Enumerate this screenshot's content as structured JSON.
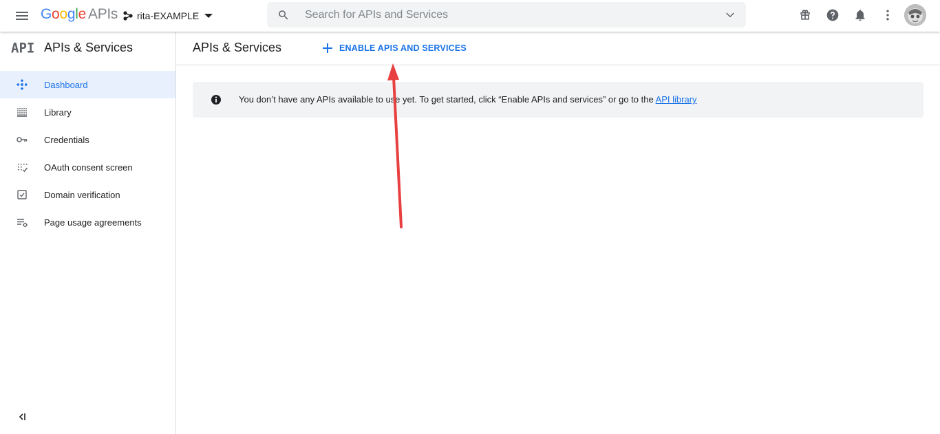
{
  "topbar": {
    "logo_letters": [
      "G",
      "o",
      "o",
      "g",
      "l",
      "e"
    ],
    "logo_suffix": "APIs",
    "project_name": "rita-EXAMPLE",
    "search_placeholder": "Search for APIs and Services"
  },
  "sidebar": {
    "logo_text": "API",
    "title": "APIs & Services",
    "items": [
      {
        "label": "Dashboard",
        "icon": "dashboard-icon",
        "active": true
      },
      {
        "label": "Library",
        "icon": "library-icon",
        "active": false
      },
      {
        "label": "Credentials",
        "icon": "key-icon",
        "active": false
      },
      {
        "label": "OAuth consent screen",
        "icon": "oauth-consent-icon",
        "active": false
      },
      {
        "label": "Domain verification",
        "icon": "checkbox-icon",
        "active": false
      },
      {
        "label": "Page usage agreements",
        "icon": "settings-list-icon",
        "active": false
      }
    ]
  },
  "main": {
    "title": "APIs & Services",
    "enable_button": "ENABLE APIS AND SERVICES",
    "notice_text": "You don’t have any APIs available to use yet. To get started, click “Enable APIs and services” or go to the ",
    "notice_link": "API library"
  },
  "colors": {
    "accent": "#1a73e8",
    "active_bg": "#e8f0fe",
    "notice_bg": "#f1f3f4",
    "annotation_arrow": "#e84040"
  }
}
